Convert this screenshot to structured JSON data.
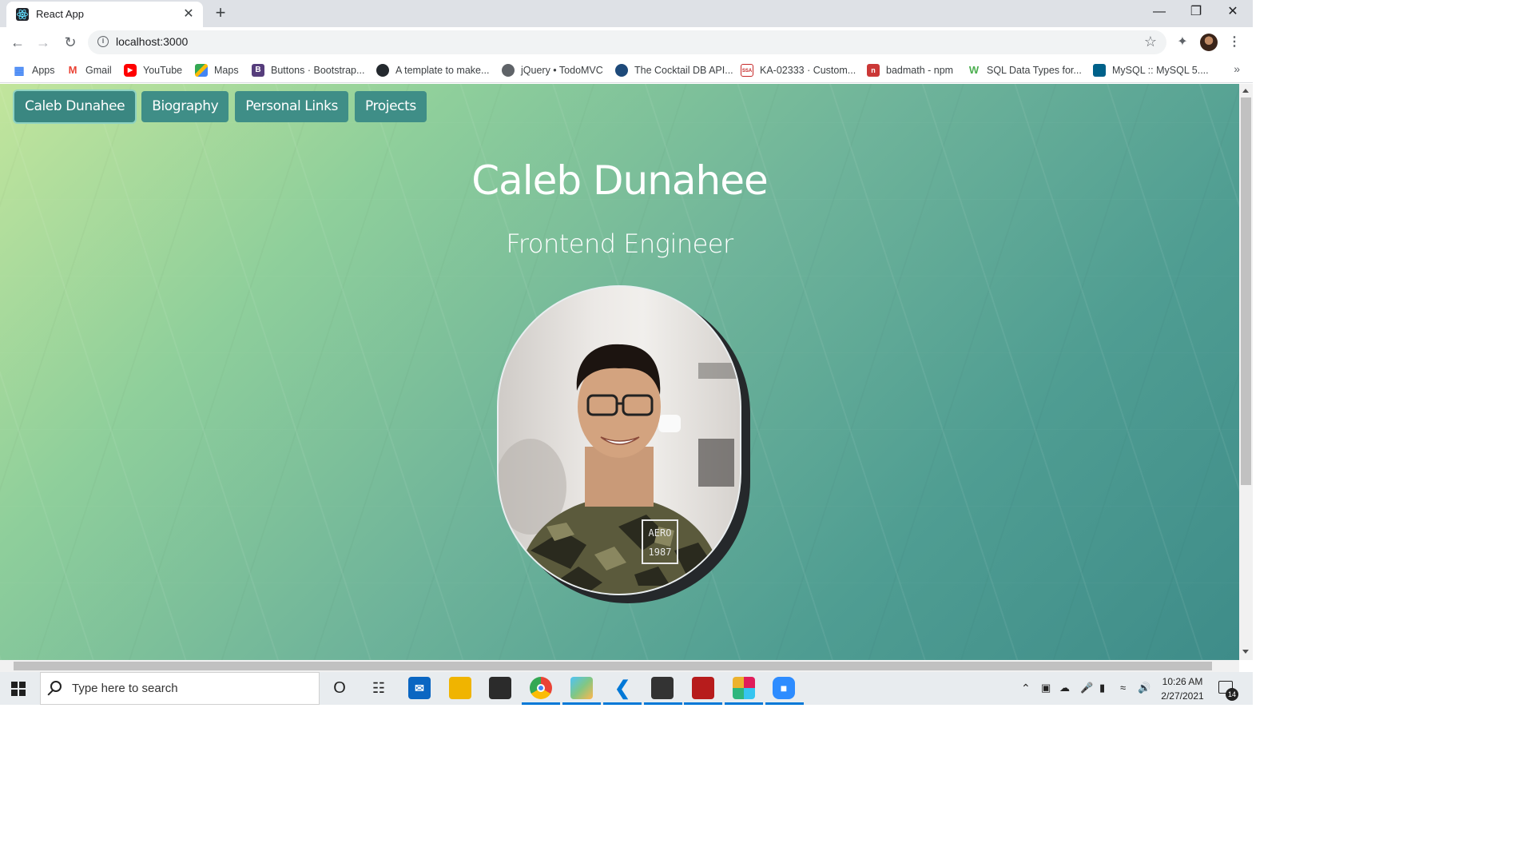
{
  "browser": {
    "tab_title": "React App",
    "url": "localhost:3000",
    "bookmarks": [
      {
        "label": "Apps",
        "icon": "apps-grid-icon",
        "color": "#4285f4"
      },
      {
        "label": "Gmail",
        "icon": "gmail-icon",
        "color": "#ea4335"
      },
      {
        "label": "YouTube",
        "icon": "youtube-icon",
        "color": "#ff0000"
      },
      {
        "label": "Maps",
        "icon": "maps-icon",
        "color": "#34a853"
      },
      {
        "label": "Buttons · Bootstrap...",
        "icon": "bootstrap-icon",
        "color": "#563d7c"
      },
      {
        "label": "A template to make...",
        "icon": "github-icon",
        "color": "#24292e"
      },
      {
        "label": "jQuery • TodoMVC",
        "icon": "globe-icon",
        "color": "#5f6368"
      },
      {
        "label": "The Cocktail DB API...",
        "icon": "cocktail-icon",
        "color": "#1e4a7a"
      },
      {
        "label": "KA-02333 · Custom...",
        "icon": "ssa-icon",
        "color": "#c62828"
      },
      {
        "label": "badmath - npm",
        "icon": "npm-icon",
        "color": "#cb3837"
      },
      {
        "label": "SQL Data Types for...",
        "icon": "w3schools-icon",
        "color": "#4caf50"
      },
      {
        "label": "MySQL :: MySQL 5....",
        "icon": "mysql-icon",
        "color": "#00618a"
      }
    ]
  },
  "page": {
    "nav": [
      {
        "label": "Caleb Dunahee",
        "active": true
      },
      {
        "label": "Biography",
        "active": false
      },
      {
        "label": "Personal Links",
        "active": false
      },
      {
        "label": "Projects",
        "active": false
      }
    ],
    "name": "Caleb Dunahee",
    "role": "Frontend Engineer",
    "shirt_text": {
      "line1": "AERO",
      "line2": "1987"
    },
    "accent_color": "#3f8e87"
  },
  "taskbar": {
    "search_placeholder": "Type here to search",
    "time": "10:26 AM",
    "date": "2/27/2021",
    "notification_count": "14",
    "apps": [
      "cortana-icon",
      "task-view-icon",
      "mail-icon",
      "file-explorer-icon",
      "store-icon",
      "chrome-icon",
      "gitkraken-icon",
      "vscode-icon",
      "mysql-workbench-icon",
      "app-red-icon",
      "slack-icon",
      "zoom-icon"
    ]
  }
}
